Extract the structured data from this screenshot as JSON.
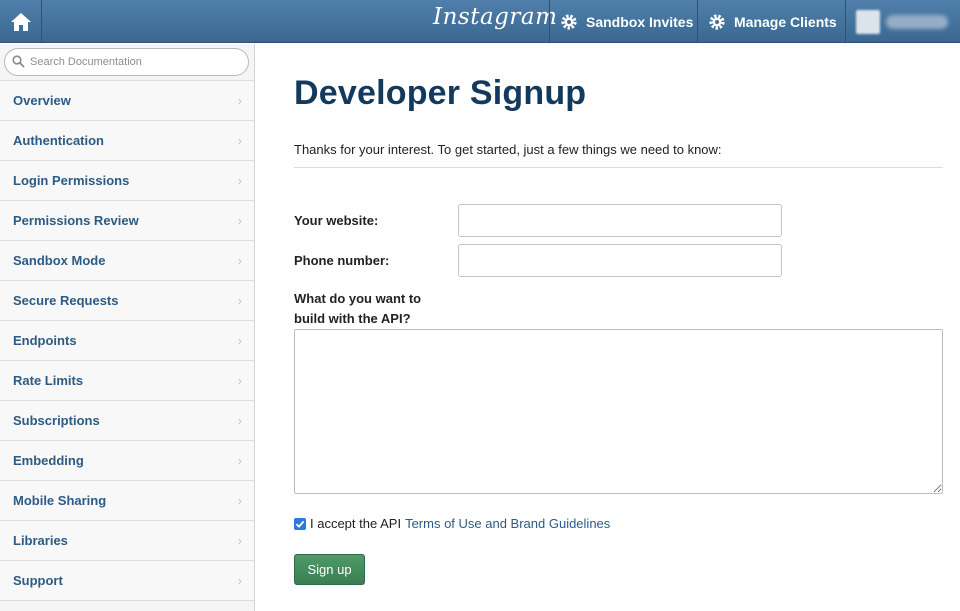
{
  "header": {
    "logo": "Instagram",
    "home_icon": "home-icon",
    "nav": [
      {
        "label": "Sandbox Invites",
        "icon": "gear-icon"
      },
      {
        "label": "Manage Clients",
        "icon": "gear-icon"
      }
    ],
    "user_avatar": "avatar-icon"
  },
  "sidebar": {
    "search_placeholder": "Search Documentation",
    "items": [
      {
        "label": "Overview"
      },
      {
        "label": "Authentication"
      },
      {
        "label": "Login Permissions"
      },
      {
        "label": "Permissions Review"
      },
      {
        "label": "Sandbox Mode"
      },
      {
        "label": "Secure Requests"
      },
      {
        "label": "Endpoints"
      },
      {
        "label": "Rate Limits"
      },
      {
        "label": "Subscriptions"
      },
      {
        "label": "Embedding"
      },
      {
        "label": "Mobile Sharing"
      },
      {
        "label": "Libraries"
      },
      {
        "label": "Support"
      }
    ]
  },
  "main": {
    "title": "Developer Signup",
    "intro": "Thanks for your interest. To get started, just a few things we need to know:",
    "website_label": "Your website:",
    "website_value": "",
    "phone_label": "Phone number:",
    "phone_value": "",
    "build_label_line1": "What do you want to",
    "build_label_line2": "build with the API?",
    "build_value": "",
    "accept_text": "I accept the API",
    "accept_link": "Terms of Use and Brand Guidelines",
    "accept_checked": true,
    "signup_label": "Sign up"
  },
  "colors": {
    "header_bg": "#4472a0",
    "title": "#14395e",
    "nav_link": "#2c5b85",
    "signup_bg": "#428a5b"
  }
}
